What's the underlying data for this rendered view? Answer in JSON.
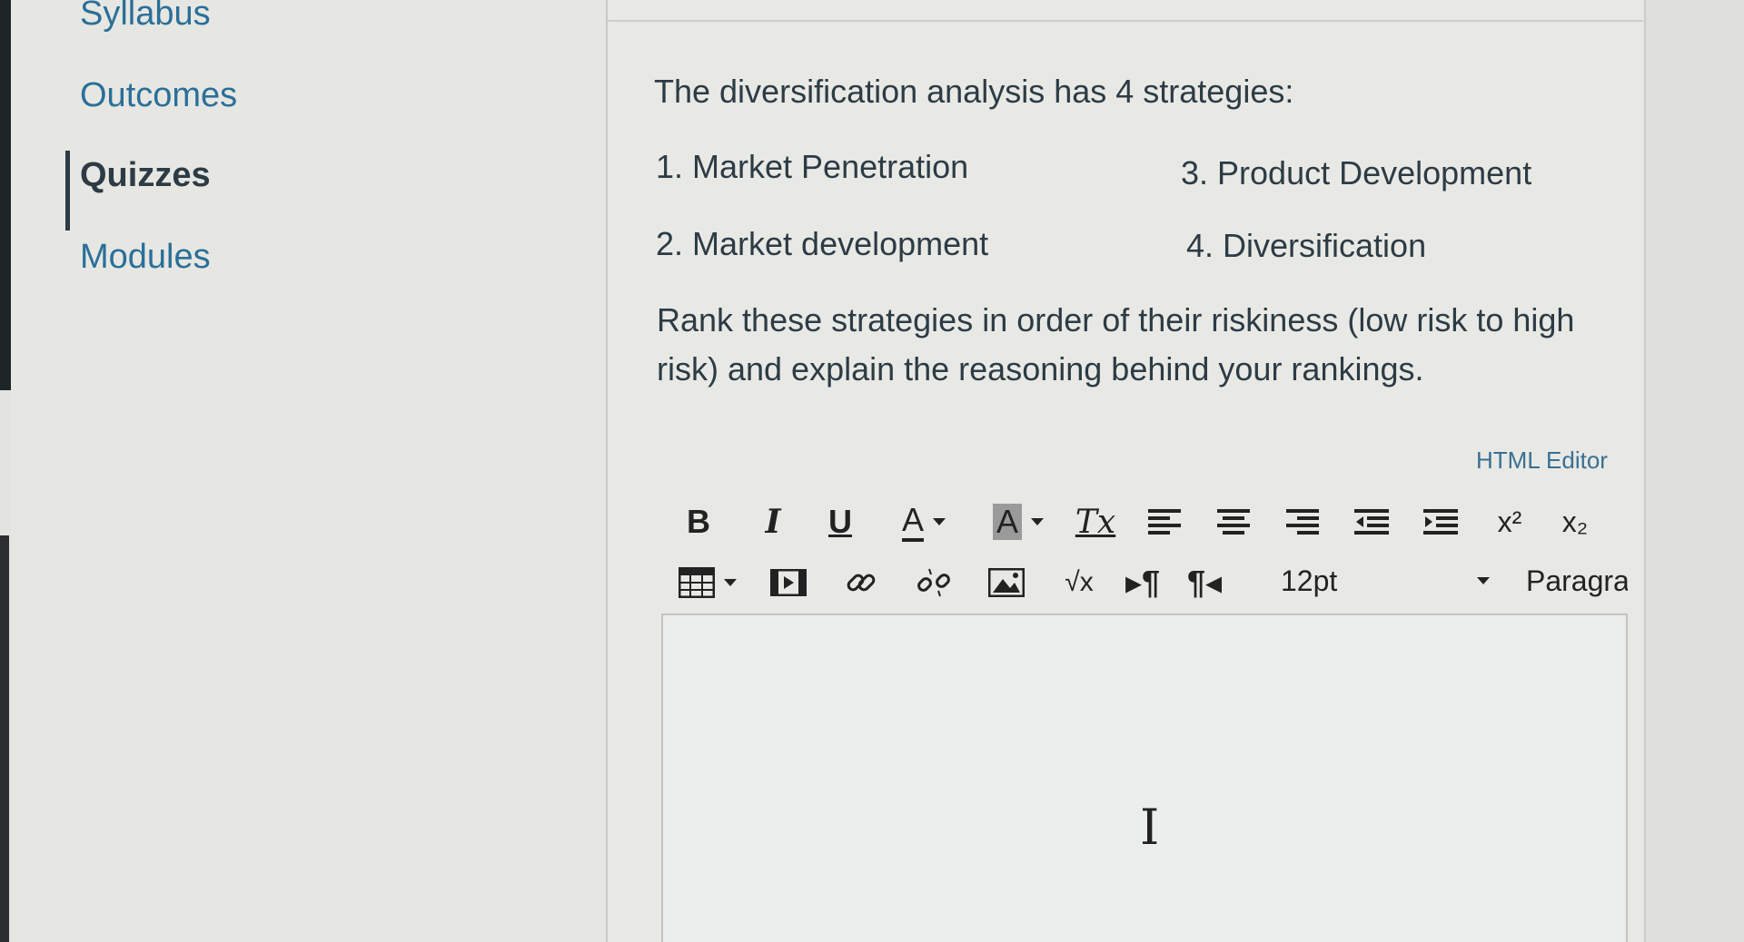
{
  "sidebar": {
    "items": [
      {
        "label": "Syllabus",
        "active": false
      },
      {
        "label": "Outcomes",
        "active": false
      },
      {
        "label": "Quizzes",
        "active": true
      },
      {
        "label": "Modules",
        "active": false
      }
    ]
  },
  "question": {
    "intro": "The diversification analysis has 4 strategies:",
    "strategies": [
      "1. Market Penetration",
      "3. Product Development",
      "2. Market development",
      "4. Diversification"
    ],
    "prompt_line1": "Rank these strategies in order of their riskiness (low risk to high",
    "prompt_line2": "risk) and explain the reasoning behind your rankings."
  },
  "editor": {
    "html_editor_link": "HTML Editor",
    "font_size": "12pt",
    "paragraph": "Paragra",
    "toolbar_row1": [
      {
        "icon": "bold-icon",
        "glyph": "B"
      },
      {
        "icon": "italic-icon",
        "glyph": "I"
      },
      {
        "icon": "underline-icon",
        "glyph": "U"
      },
      {
        "icon": "text-color-icon",
        "glyph": "A"
      },
      {
        "icon": "background-color-icon",
        "glyph": "A"
      },
      {
        "icon": "clear-formatting-icon",
        "glyph": "Tx"
      },
      {
        "icon": "align-left-icon"
      },
      {
        "icon": "align-center-icon"
      },
      {
        "icon": "align-right-icon"
      },
      {
        "icon": "outdent-icon"
      },
      {
        "icon": "indent-icon"
      },
      {
        "icon": "superscript-icon",
        "glyph": "x²"
      },
      {
        "icon": "subscript-icon",
        "glyph": "x₂"
      }
    ],
    "toolbar_row2": [
      {
        "icon": "table-icon"
      },
      {
        "icon": "media-icon"
      },
      {
        "icon": "link-icon"
      },
      {
        "icon": "unlink-icon"
      },
      {
        "icon": "image-icon"
      },
      {
        "icon": "equation-icon",
        "glyph": "√x"
      },
      {
        "icon": "ltr-icon",
        "glyph": "¶"
      },
      {
        "icon": "rtl-icon",
        "glyph": "¶"
      }
    ],
    "content": ""
  }
}
